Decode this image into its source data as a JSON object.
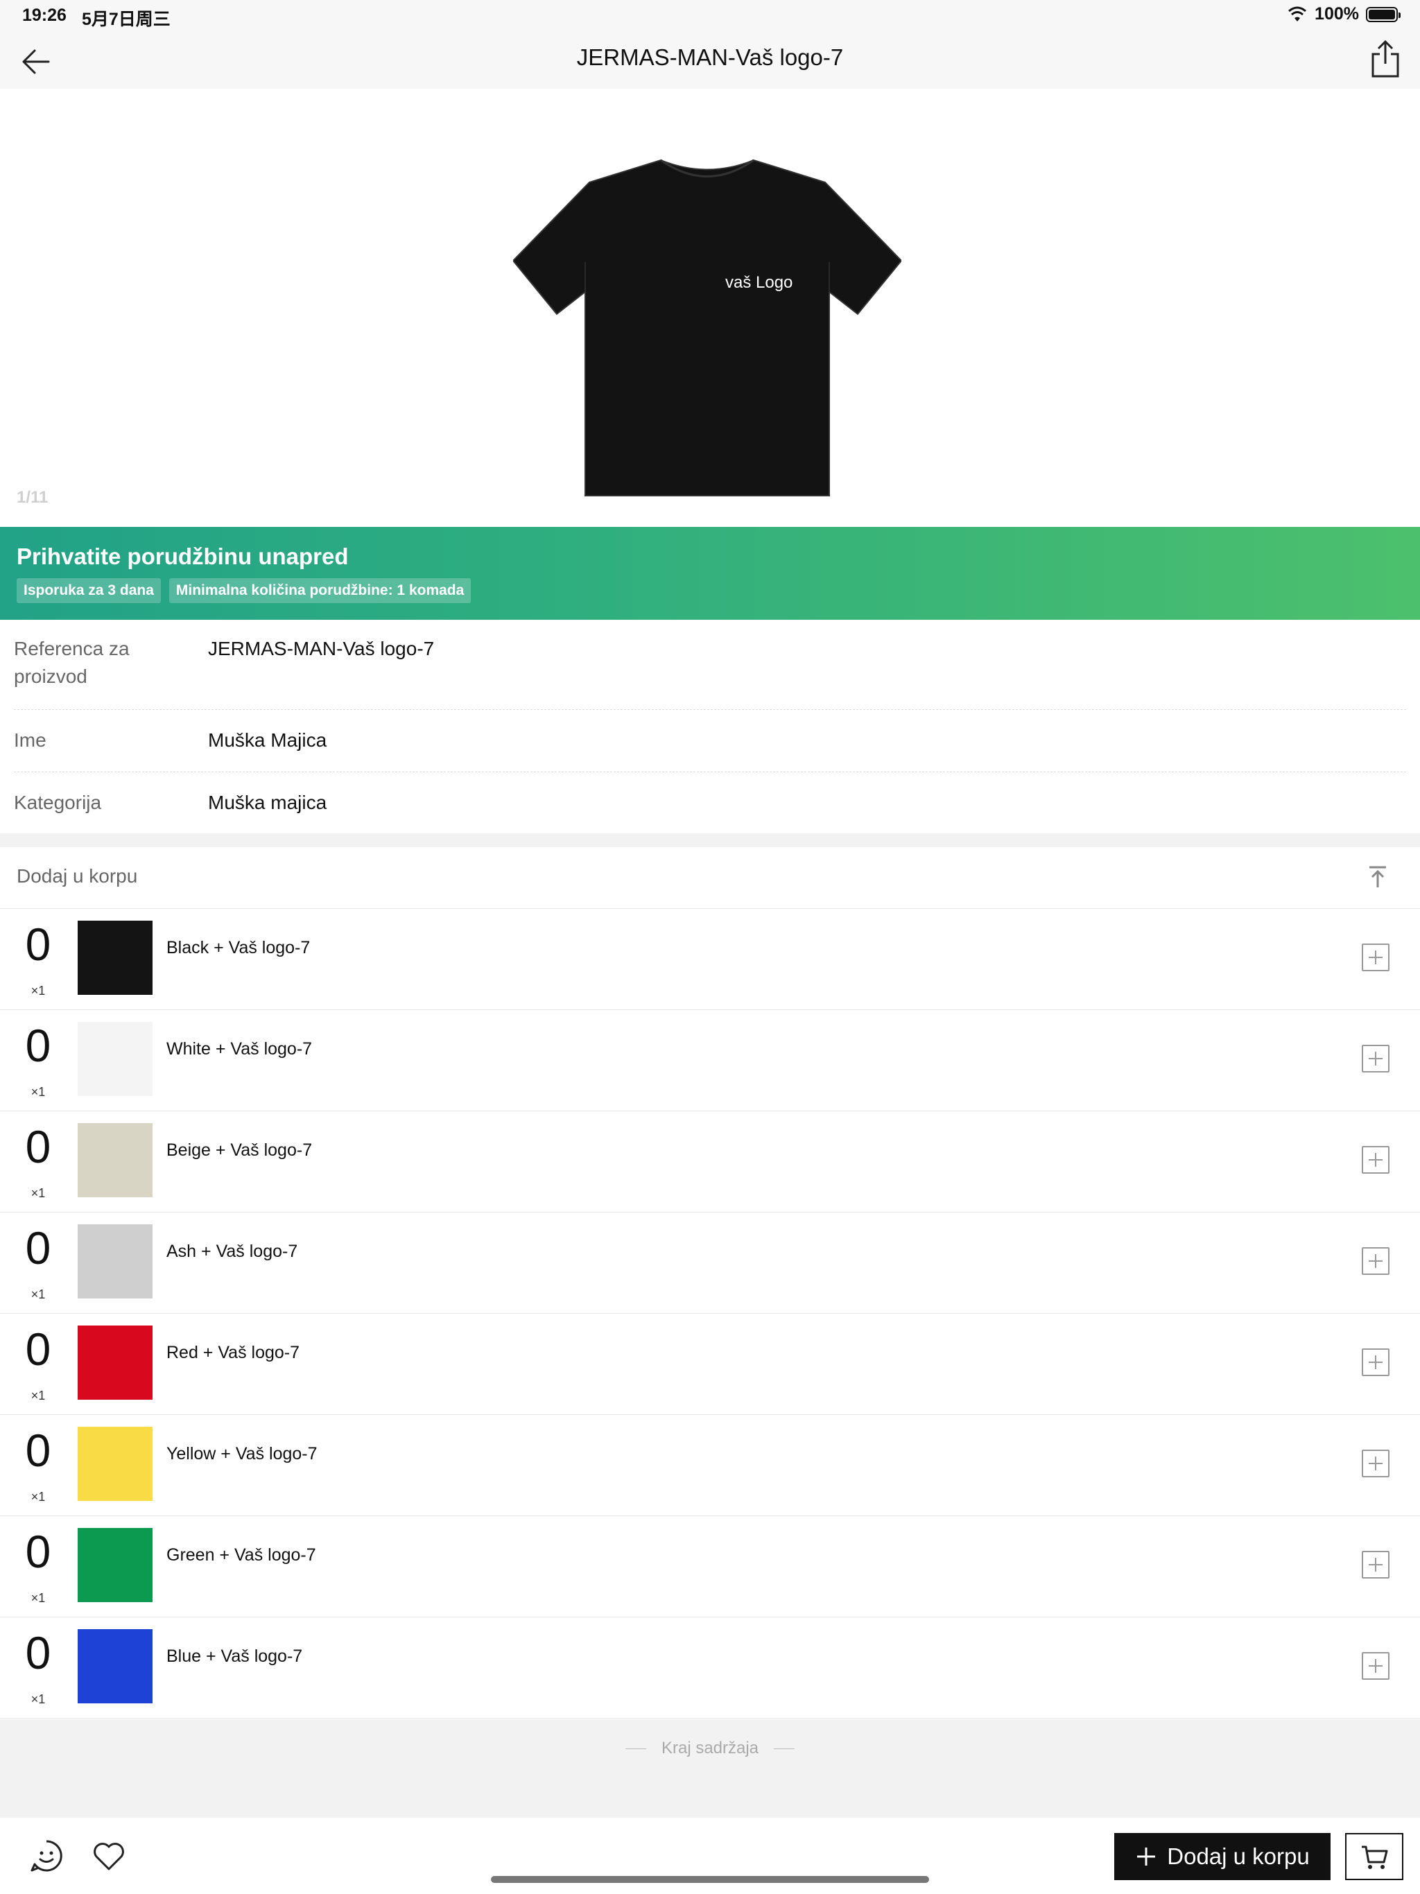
{
  "status_bar": {
    "time": "19:26",
    "date": "5月7日周三",
    "battery": "100%"
  },
  "nav": {
    "title": "JERMAS-MAN-Vaš logo-7"
  },
  "gallery": {
    "logo_text": "vaš Logo",
    "counter": "1/11"
  },
  "banner": {
    "headline": "Prihvatite porudžbinu unapred",
    "tags": [
      "Isporuka za 3 dana",
      "Minimalna količina porudžbine: 1 komada"
    ]
  },
  "info": [
    {
      "label": "Referenca za proizvod",
      "value": "JERMAS-MAN-Vaš logo-7"
    },
    {
      "label": "Ime",
      "value": "Muška Majica"
    },
    {
      "label": "Kategorija",
      "value": "Muška majica"
    }
  ],
  "cart": {
    "header": "Dodaj u korpu",
    "variants": [
      {
        "qty": "0",
        "mult": "×1",
        "name": "Black + Vaš logo-7",
        "color": "#141414"
      },
      {
        "qty": "0",
        "mult": "×1",
        "name": "White + Vaš logo-7",
        "color": "#f4f4f4"
      },
      {
        "qty": "0",
        "mult": "×1",
        "name": "Beige + Vaš logo-7",
        "color": "#d9d5c5"
      },
      {
        "qty": "0",
        "mult": "×1",
        "name": "Ash + Vaš logo-7",
        "color": "#cfcfcf"
      },
      {
        "qty": "0",
        "mult": "×1",
        "name": "Red + Vaš logo-7",
        "color": "#d8091f"
      },
      {
        "qty": "0",
        "mult": "×1",
        "name": "Yellow + Vaš logo-7",
        "color": "#f8db45"
      },
      {
        "qty": "0",
        "mult": "×1",
        "name": "Green + Vaš logo-7",
        "color": "#0b9a4f"
      },
      {
        "qty": "0",
        "mult": "×1",
        "name": "Blue + Vaš logo-7",
        "color": "#1e42d6"
      }
    ],
    "end_text": "Kraj sadržaja"
  },
  "bottom_bar": {
    "add_to_cart": "Dodaj u korpu"
  },
  "icons": [
    "back-arrow-icon",
    "share-icon",
    "scroll-to-top-icon",
    "plus-icon",
    "chat-icon",
    "heart-icon",
    "cart-icon",
    "wifi-icon",
    "battery-icon"
  ]
}
